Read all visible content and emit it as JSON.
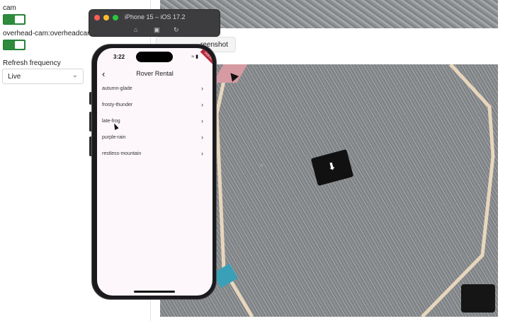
{
  "panel": {
    "cam_label": "cam",
    "overhead_label": "overhead-cam:overheadcam",
    "refresh_label": "Refresh frequency",
    "refresh_value": "Live"
  },
  "camera": {
    "screenshot_label": "Screenshot",
    "screenshot_visible": "reenshot"
  },
  "simulator": {
    "title": "iPhone 15 – iOS 17.2",
    "traffic_colors": [
      "#ff5f57",
      "#febc2e",
      "#28c840"
    ]
  },
  "phone": {
    "time": "3:22",
    "debug_banner": "DEBUG",
    "app_title": "Rover Rental",
    "rovers": [
      {
        "name": "autumn-glade"
      },
      {
        "name": "frosty-thunder"
      },
      {
        "name": "late-frog"
      },
      {
        "name": "purple-rain"
      },
      {
        "name": "restless-mountain"
      }
    ]
  },
  "colors": {
    "toggle_on": "#2e8b3c",
    "debug": "#b8263a"
  }
}
